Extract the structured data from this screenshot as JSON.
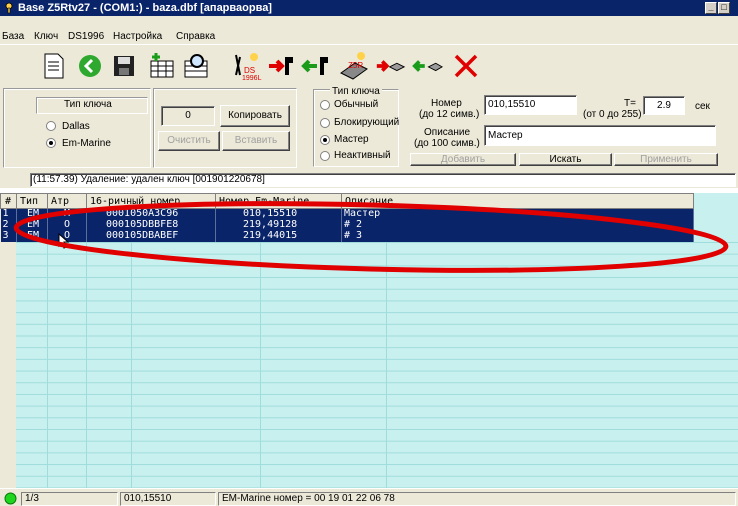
{
  "window": {
    "title": "Base Z5Rtv27 - (COM1:) - baza.dbf [апарваорва]"
  },
  "menu": [
    "База",
    "Ключ",
    "DS1996",
    "Настройка",
    "Справка"
  ],
  "toolbar": {
    "ds1996_label": "DS\n1996L",
    "z5r_label": "Z5R"
  },
  "key_type_group": {
    "title": "Тип ключа",
    "options": [
      {
        "label": "Dallas",
        "selected": false
      },
      {
        "label": "Em-Marine",
        "selected": true
      }
    ]
  },
  "buffer": {
    "value": "0",
    "copy_label": "Копировать",
    "clear_label": "Очистить",
    "paste_label": "Вставить"
  },
  "key_kind_group": {
    "title": "Тип ключа",
    "options": [
      {
        "label": "Обычный",
        "selected": false
      },
      {
        "label": "Блокирующий",
        "selected": false
      },
      {
        "label": "Мастер",
        "selected": true
      },
      {
        "label": "Неактивный",
        "selected": false
      }
    ]
  },
  "number_field": {
    "label_line1": "Номер",
    "label_line2": "(до 12 симв.)",
    "value": "010,15510"
  },
  "t_field": {
    "label_line1": "T=",
    "label_line2": "(от 0 до 255)",
    "value": "2.9",
    "unit": "сек"
  },
  "description_field": {
    "label_line1": "Описание",
    "label_line2": "(до 100 симв.)",
    "value": "Мастер"
  },
  "actions": {
    "add_label": "Добавить",
    "search_label": "Искать",
    "apply_label": "Применить"
  },
  "log_line": "(11:57.39) Удаление: удален ключ [001901220678]",
  "table": {
    "headers": [
      "#",
      "Тип",
      "Атр",
      "16-ричный номер",
      "Номер Em-Marine",
      "Описание"
    ],
    "rows": [
      [
        "1",
        "EM",
        "M",
        "0001050A3C96",
        "010,15510",
        "Мастер"
      ],
      [
        "2",
        "EM",
        "O",
        "000105DBBFE8",
        "219,49128",
        "# 2"
      ],
      [
        "3",
        "EM",
        "O",
        "000105DBABEF",
        "219,44015",
        "# 3"
      ]
    ]
  },
  "statusbar": {
    "position": "1/3",
    "number": "010,15510",
    "info": "EM-Marine номер = 00 19 01 22 06 78"
  },
  "colors": {
    "title_bar": "#0a246a",
    "grid_bg": "#c8f0ef",
    "selection": "#0a246a",
    "annotation": "#e00000"
  }
}
